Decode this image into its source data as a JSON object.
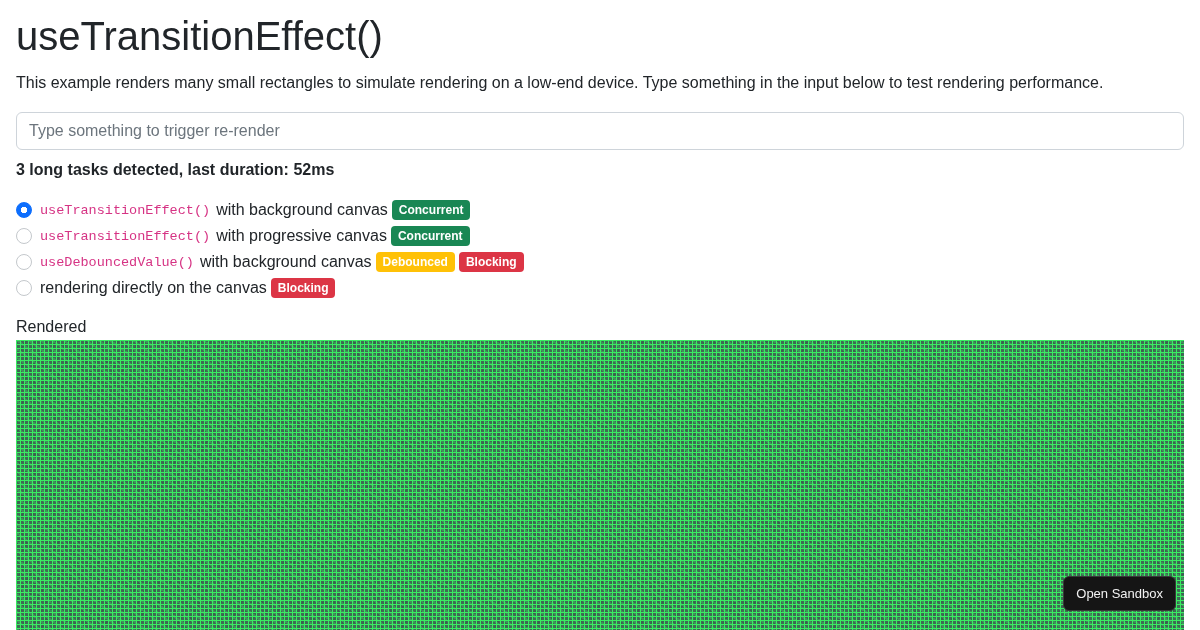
{
  "title": "useTransitionEffect()",
  "description": "This example renders many small rectangles to simulate rendering on a low-end device. Type something in the input below to test rendering performance.",
  "input": {
    "placeholder": "Type something to trigger re-render"
  },
  "status": "3 long tasks detected, last duration: 52ms",
  "options": [
    {
      "code": "useTransitionEffect()",
      "label": "with background canvas",
      "selected": true,
      "badges": [
        {
          "text": "Concurrent",
          "color": "#198754"
        }
      ]
    },
    {
      "code": "useTransitionEffect()",
      "label": "with progressive canvas",
      "selected": false,
      "badges": [
        {
          "text": "Concurrent",
          "color": "#198754"
        }
      ]
    },
    {
      "code": "useDebouncedValue()",
      "label": "with background canvas",
      "selected": false,
      "badges": [
        {
          "text": "Debounced",
          "color": "#ffc107"
        },
        {
          "text": "Blocking",
          "color": "#dc3545"
        }
      ]
    },
    {
      "label": "rendering directly on the canvas",
      "selected": false,
      "badges": [
        {
          "text": "Blocking",
          "color": "#dc3545"
        }
      ]
    }
  ],
  "canvas": {
    "label": "Rendered"
  },
  "sandbox_button": "Open Sandbox"
}
